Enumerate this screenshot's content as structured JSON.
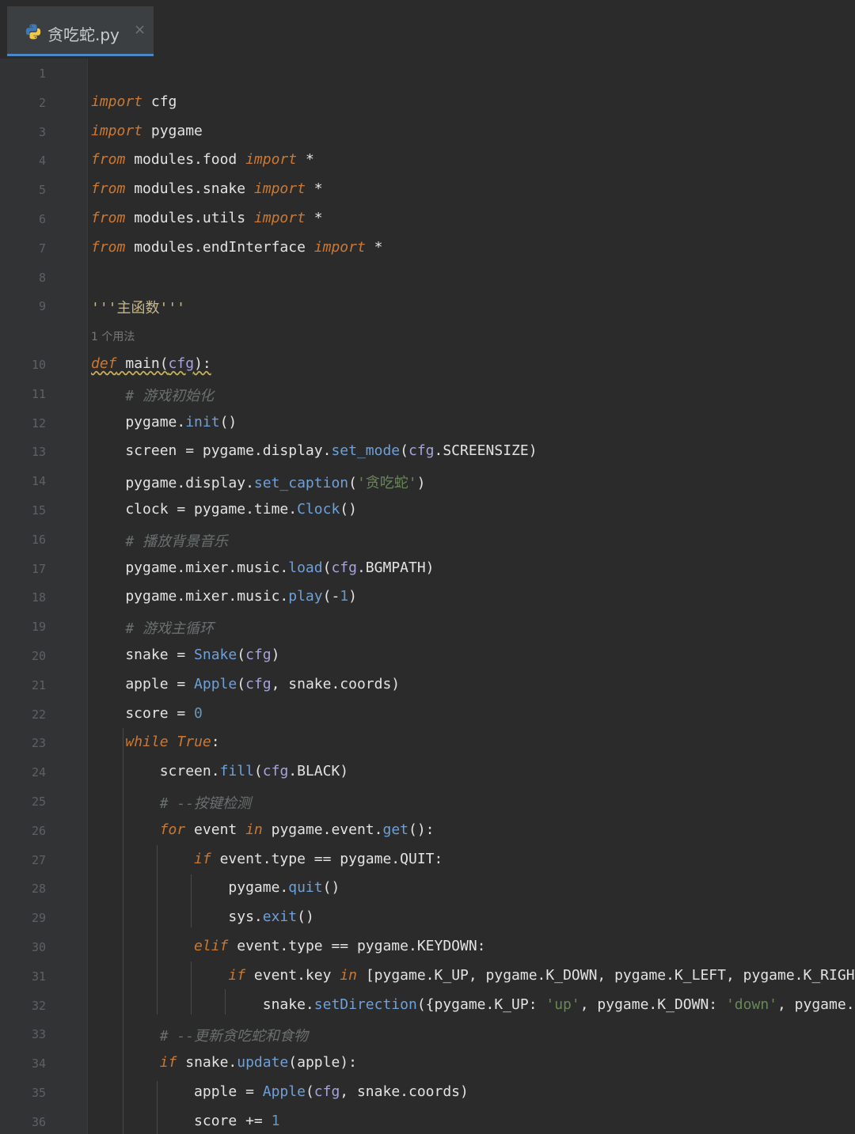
{
  "tab": {
    "filename": "贪吃蛇.py",
    "close": "×",
    "icon": "python-file-icon"
  },
  "usages_hint": "1 个用法",
  "lines": [
    {
      "n": "1",
      "t": ""
    },
    {
      "n": "2",
      "t": "import cfg"
    },
    {
      "n": "3",
      "t": "import pygame"
    },
    {
      "n": "4",
      "t": "from modules.food import *"
    },
    {
      "n": "5",
      "t": "from modules.snake import *"
    },
    {
      "n": "6",
      "t": "from modules.utils import *"
    },
    {
      "n": "7",
      "t": "from modules.endInterface import *"
    },
    {
      "n": "8",
      "t": ""
    },
    {
      "n": "9",
      "t": "'''主函数'''"
    },
    {
      "n": "10",
      "t": "def main(cfg):"
    },
    {
      "n": "11",
      "t": "    # 游戏初始化"
    },
    {
      "n": "12",
      "t": "    pygame.init()"
    },
    {
      "n": "13",
      "t": "    screen = pygame.display.set_mode(cfg.SCREENSIZE)"
    },
    {
      "n": "14",
      "t": "    pygame.display.set_caption('贪吃蛇')"
    },
    {
      "n": "15",
      "t": "    clock = pygame.time.Clock()"
    },
    {
      "n": "16",
      "t": "    # 播放背景音乐"
    },
    {
      "n": "17",
      "t": "    pygame.mixer.music.load(cfg.BGMPATH)"
    },
    {
      "n": "18",
      "t": "    pygame.mixer.music.play(-1)"
    },
    {
      "n": "19",
      "t": "    # 游戏主循环"
    },
    {
      "n": "20",
      "t": "    snake = Snake(cfg)"
    },
    {
      "n": "21",
      "t": "    apple = Apple(cfg, snake.coords)"
    },
    {
      "n": "22",
      "t": "    score = 0"
    },
    {
      "n": "23",
      "t": "    while True:"
    },
    {
      "n": "24",
      "t": "        screen.fill(cfg.BLACK)"
    },
    {
      "n": "25",
      "t": "        # --按键检测"
    },
    {
      "n": "26",
      "t": "        for event in pygame.event.get():"
    },
    {
      "n": "27",
      "t": "            if event.type == pygame.QUIT:"
    },
    {
      "n": "28",
      "t": "                pygame.quit()"
    },
    {
      "n": "29",
      "t": "                sys.exit()"
    },
    {
      "n": "30",
      "t": "            elif event.type == pygame.KEYDOWN:"
    },
    {
      "n": "31",
      "t": "                if event.key in [pygame.K_UP, pygame.K_DOWN, pygame.K_LEFT, pygame.K_RIGHT"
    },
    {
      "n": "32",
      "t": "                    snake.setDirection({pygame.K_UP: 'up', pygame.K_DOWN: 'down', pygame.K"
    },
    {
      "n": "33",
      "t": "        # --更新贪吃蛇和食物"
    },
    {
      "n": "34",
      "t": "        if snake.update(apple):"
    },
    {
      "n": "35",
      "t": "            apple = Apple(cfg, snake.coords)"
    },
    {
      "n": "36",
      "t": "            score += 1"
    }
  ]
}
